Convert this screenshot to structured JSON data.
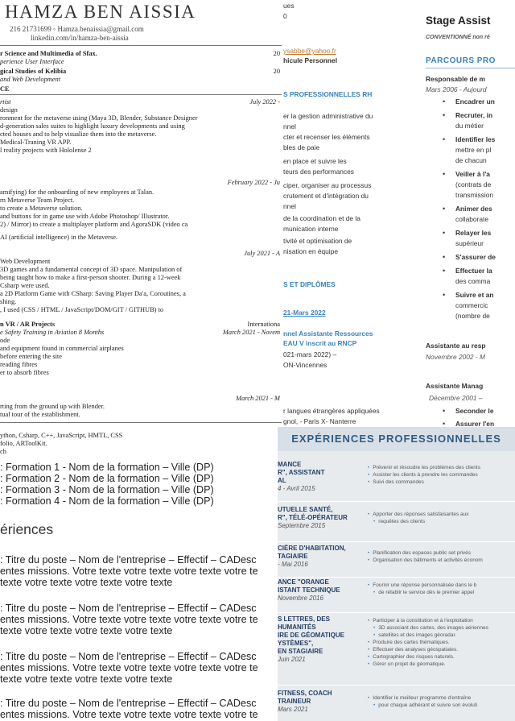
{
  "fragA": {
    "name": "HAMZA BEN AISSIA",
    "contact1": "216 21731699 ◦ Hamza.benaissia@gmail.com",
    "contact2": "linkedin.com/in/hamza-ben-aissia",
    "lines": [
      "r Science and Multimedia of Sfax.",
      "perience User Interface",
      "gical Studies of Kelibia",
      "and Web Development",
      "CE",
      "rtist",
      "design",
      "ronment for the metaverse using (Maya 3D, Blender, Substance Designer",
      "d-generation sales suites to highlight luxury developments and using",
      "cted houses and to help visualize them into the metaverse.",
      "Medical-Traning VR APP.",
      "l reality projects with Hololense 2",
      "amifying) for the onboarding of new employees at Talan.",
      "rn Metaverse Team Project.",
      "to create a Metaverse solution.",
      "and buttons for in game use with Adobe Photoshop/ Illustrator.",
      "2) / Mirror) to create a multiplayer platform and AgoraSDK (video ca",
      "AI (artificial intelligence) in the Metaverse.",
      "Web Development",
      "3D games and a fundamental concept of 3D space. Manipulation of",
      "being taught how to make a first-person shooter. During a 12-week",
      "Csharp were used.",
      "a 2D Platform Game with CSharp: Saving Player Da'a, Coroutines, a",
      "shing.",
      ", I used (CSS / HTML / JavaScript/DOM/GIT / GITHUB) to",
      "n VR / AR Projects",
      "e Safety Training in Aviation 8 Months",
      "ode",
      "and equipment found in commercial airplanes",
      "before entering the site",
      "reading fibres",
      "er to absorb fibres",
      "rting from the ground up with Blender.",
      "tual tour of the establishment.",
      "ython, Csharp, C++, JavaScript, HMTL, CSS",
      "folio, ARToolKit.",
      "ch"
    ],
    "right_dates": [
      "20",
      "20",
      "July 2022 -",
      "February 2022 - Ju",
      "July 2021 - A",
      "Internationa",
      "March 2021 - Novem",
      "March 2021 - M"
    ]
  },
  "fragB": {
    "lines": [
      "ues",
      "0",
      "ysabbe@yahoo.fr",
      "hicule Personnel",
      "S PROFESSIONNELLES RH",
      "er la gestion administrative du",
      "nnel",
      "cter et recenser les éléments",
      "bles de paie",
      "en place et suivre les",
      "teurs des performances",
      "ciper, organiser au processus",
      "crutement et d'intégration du",
      "nnel",
      "de la coordination et de la",
      "munication interne",
      "tivité et optimisation de",
      "nisation en équipe",
      "S ET DIPLÔMES",
      "21-Mars 2022",
      "nnel Assistante Ressources",
      "EAU V inscrit au RNCP",
      "021-mars 2022) –",
      "ON-Vincennes",
      "r langues étrangères appliquées",
      "gnol, - Paris X- Nanterre"
    ]
  },
  "fragC": {
    "title": "Stage Assist",
    "subtitle": "CONVENTIONNÉ non ré",
    "section": "PARCOURS PRO",
    "job1": "Responsable de m",
    "job1_date": "Mars 2006 - Aujourd",
    "bullets": [
      [
        "Encadrer un",
        ""
      ],
      [
        "Recruter, in",
        "du métier"
      ],
      [
        "Identifier les",
        "mettre en pl",
        "de chacun"
      ],
      [
        "Veiller à l'a",
        "(contrats de",
        "transmission"
      ],
      [
        "Animer des",
        "collaborate"
      ],
      [
        "Relayer les",
        "supérieur"
      ],
      [
        "S'assurer de",
        ""
      ],
      [
        "Effectuer la",
        "des comma"
      ],
      [
        "Suivre et an",
        "commercic",
        "(nombre de"
      ]
    ],
    "job2": "Assistante au resp",
    "job2_date": "Novembre 2002 - M",
    "job3": "Assistante Manag",
    "job3_date": "Décembre 2001 –",
    "job3_bullets": [
      "Seconder le",
      "Assurer l'en"
    ]
  },
  "fragD": {
    "formations": [
      ": Formation 1 - Nom de la formation  – Ville (DP)",
      ": Formation 2 - Nom de la formation  – Ville (DP)",
      ": Formation 3 - Nom de la formation  – Ville (DP)",
      ": Formation 4 - Nom de la formation  – Ville (DP)"
    ],
    "heading": "ériences",
    "entries": [
      [
        ": Titre du poste – Nom de l'entreprise – Effectif – CADesc",
        "entes missions. Votre texte votre texte votre texte votre te",
        "texte votre texte votre texte votre texte"
      ],
      [
        ": Titre du poste – Nom de l'entreprise – Effectif – CADesc",
        "entes missions. Votre texte votre texte votre texte votre te",
        "texte votre texte votre texte votre texte"
      ],
      [
        ": Titre du poste – Nom de l'entreprise – Effectif – CADesc",
        "entes missions. Votre texte votre texte votre texte votre te",
        "texte votre texte votre texte votre texte"
      ],
      [
        ": Titre du poste – Nom de l'entreprise – Effectif – CADesc",
        "entes missions. Votre texte votre texte votre texte votre te",
        "texte votre texte votre texte votre texte"
      ]
    ]
  },
  "fragE": {
    "heading": "EXPÉRIENCES PROFESSIONNELLES",
    "rows": [
      {
        "title": [
          "MANCE",
          "R\", ASSISTANT",
          "AL"
        ],
        "date": "4 - Avril 2015",
        "items": [
          "Prévenir et résoudre les problèmes des clients",
          "Assister les clients à prendre les commandes",
          "Suivi des commandes"
        ]
      },
      {
        "title": [
          "UTUELLE SANTÉ,",
          "R\", TÉLÉ-OPÉRATEUR"
        ],
        "date": "Septembre 2015",
        "items": [
          "Apporter des réponses satisfaisantes aux",
          "requêtes des clients"
        ]
      },
      {
        "title": [
          "CIÈRE D'HABITATION,",
          "TAGIAIRE"
        ],
        "date": "- Mai 2016",
        "items": [
          "Planification des espaces public set privés",
          "Organisation des bâtiments et activités économ"
        ]
      },
      {
        "title": [
          "ANCE \"ORANGE",
          "ISTANT TECHNIQUE"
        ],
        "date": "Novembre 2016",
        "items": [
          "Fournir une réponse personnalisée dans le b",
          "de rétablir le service dès le premier appel"
        ]
      },
      {
        "title": [
          "S LETTRES, DES",
          "HUMANITÉS",
          "IRE DE GÉOMATIQUE",
          "YSTÈMES\",",
          "EN STAGIAIRE"
        ],
        "date": "Juin 2021",
        "items": [
          "Participer à la constitution et à l'exploitation",
          "3D associant des cartes, des images aériennes",
          "satellites et des images géoradar.",
          "Produire des cartes thématiques.",
          "Effectuer des analyses géospatiales.",
          "Cartographier des risques naturels.",
          "Gérer un projet de géomatique."
        ]
      },
      {
        "title": [
          "FITNESS, COACH",
          "TRAINEUR"
        ],
        "date": "Mars 2021",
        "items": [
          "Identifier le meilleur programme d'entraîne",
          "pour chaque adhérant et suivre son évoluti"
        ]
      }
    ]
  }
}
